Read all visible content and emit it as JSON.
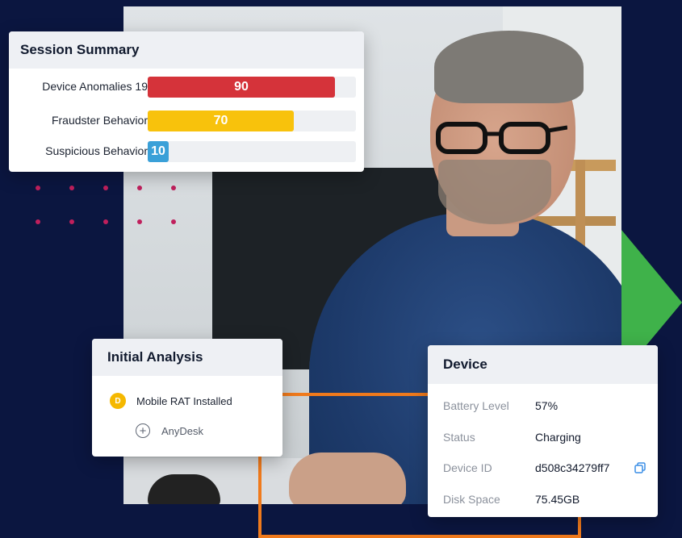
{
  "colors": {
    "background": "#0b1640",
    "bar_red": "#d5333a",
    "bar_yellow": "#f8c20c",
    "bar_blue": "#3aa0d8",
    "accent_magenta": "#c01f5c",
    "accent_green": "#3fb24a",
    "accent_orange": "#f07a1c",
    "badge_yellow": "#f5b800"
  },
  "session_summary": {
    "title": "Session Summary",
    "rows": [
      {
        "label": "Device Anomalies 19",
        "value": 90,
        "value_text": "90",
        "color": "#d5333a"
      },
      {
        "label": "Fraudster Behavior",
        "value": 70,
        "value_text": "70",
        "color": "#f8c20c"
      },
      {
        "label": "Suspicious Behavior",
        "value": 10,
        "value_text": "10",
        "color": "#3aa0d8"
      }
    ]
  },
  "initial_analysis": {
    "title": "Initial Analysis",
    "items": [
      {
        "badge": "D",
        "label": "Mobile RAT Installed",
        "icon": "badge-d-icon"
      },
      {
        "label": "AnyDesk",
        "icon": "plus-circle-icon"
      }
    ]
  },
  "device": {
    "title": "Device",
    "fields": [
      {
        "key": "Battery Level",
        "value": "57%"
      },
      {
        "key": "Status",
        "value": "Charging"
      },
      {
        "key": "Device ID",
        "value": "d508c34279ff7",
        "icon": "copy-icon"
      },
      {
        "key": "Disk Space",
        "value": "75.45GB"
      }
    ]
  }
}
